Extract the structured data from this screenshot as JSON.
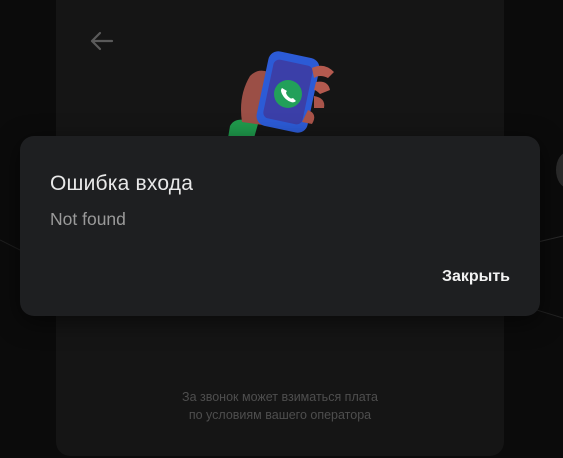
{
  "dialog": {
    "title": "Ошибка входа",
    "message": "Not found",
    "close_label": "Закрыть"
  },
  "background": {
    "charge_note_line1": "За звонок может взиматься плата",
    "charge_note_line2": "по условиям вашего оператора",
    "back_icon": "arrow-left-icon",
    "illustration": "phone-call-illustration"
  },
  "colors": {
    "page_bg": "#0b0b0b",
    "card_bg": "#151515",
    "dialog_bg": "#1e1f21",
    "title_color": "#e8e8e8",
    "message_color": "#9a9a9a",
    "accent_green": "#22a05a",
    "phone_blue": "#2c5bd6"
  }
}
